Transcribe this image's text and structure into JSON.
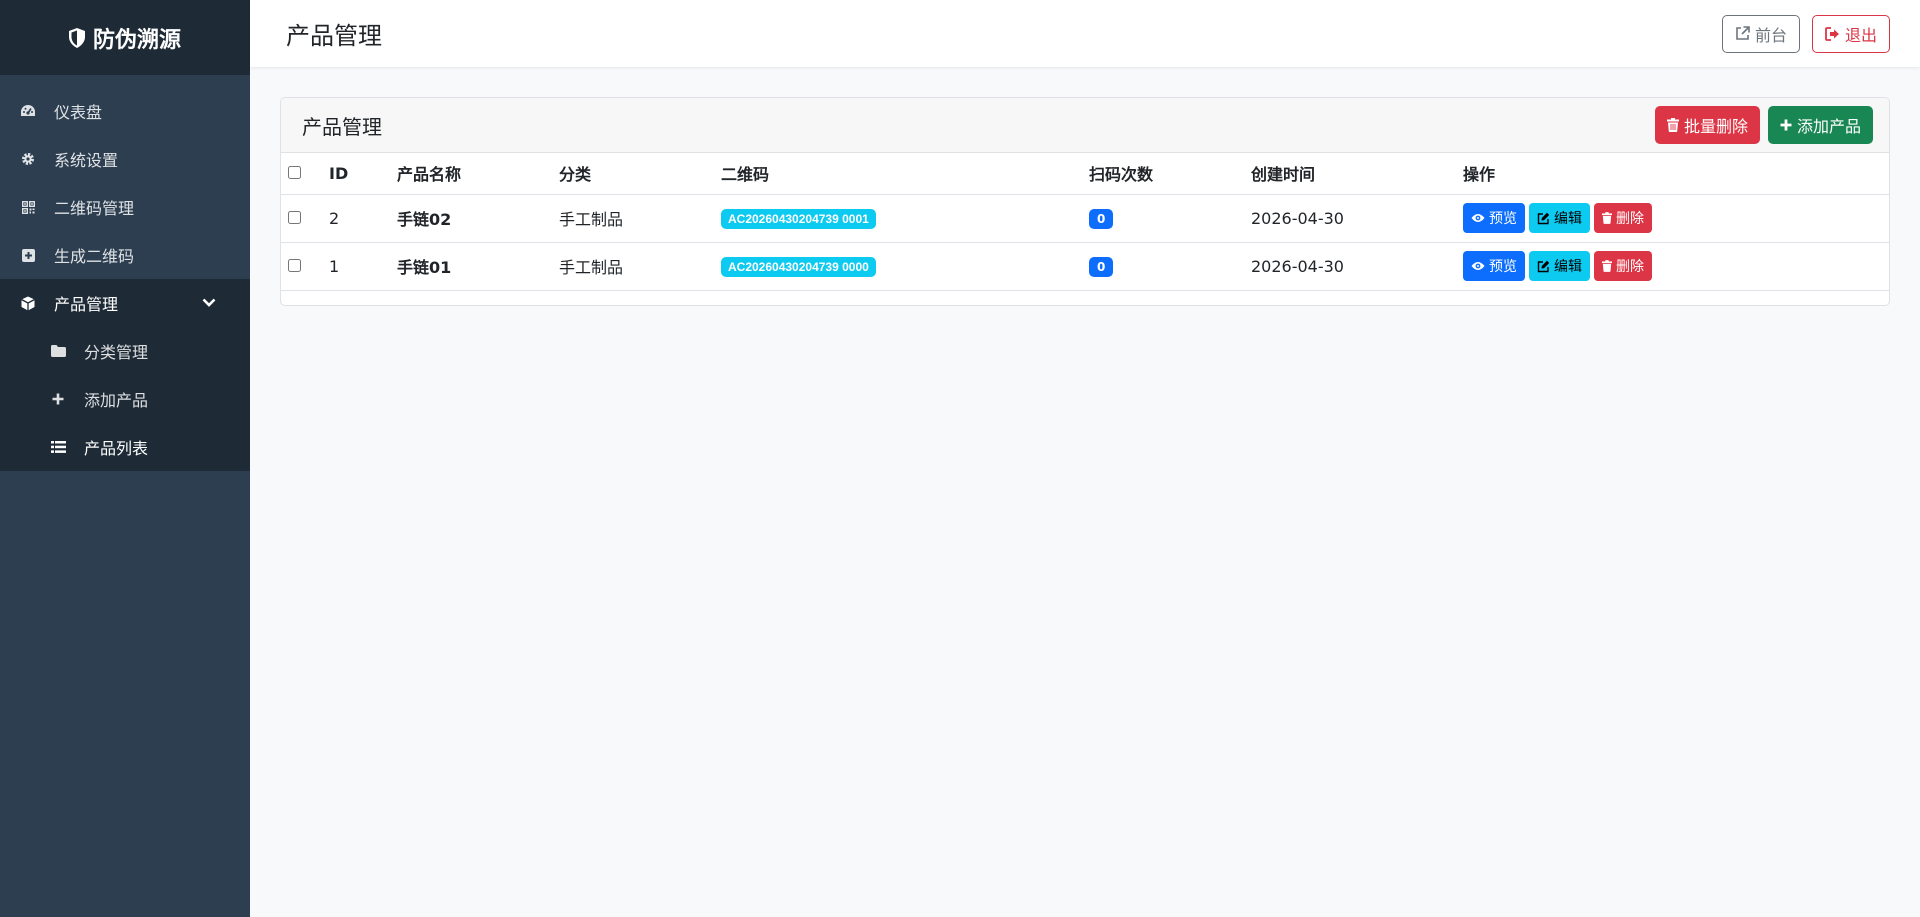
{
  "brand": {
    "title": "防伪溯源"
  },
  "sidebar": {
    "items": [
      {
        "label": "仪表盘",
        "icon": "dashboard-icon"
      },
      {
        "label": "系统设置",
        "icon": "gear-icon"
      },
      {
        "label": "二维码管理",
        "icon": "qrcode-icon"
      },
      {
        "label": "生成二维码",
        "icon": "plus-square-icon"
      },
      {
        "label": "产品管理",
        "icon": "cube-icon",
        "expanded": true
      }
    ],
    "submenu": [
      {
        "label": "分类管理",
        "icon": "folder-icon"
      },
      {
        "label": "添加产品",
        "icon": "plus-icon"
      },
      {
        "label": "产品列表",
        "icon": "list-icon",
        "active": true
      }
    ]
  },
  "header": {
    "title": "产品管理",
    "frontend_label": "前台",
    "logout_label": "退出"
  },
  "card": {
    "title": "产品管理",
    "batch_delete_label": "批量删除",
    "add_product_label": "添加产品"
  },
  "table": {
    "columns": [
      "ID",
      "产品名称",
      "分类",
      "二维码",
      "扫码次数",
      "创建时间",
      "操作"
    ],
    "rows": [
      {
        "id": "2",
        "name": "手链02",
        "category": "手工制品",
        "qrcode": "AC20260430204739 0001",
        "scans": "0",
        "created": "2026-04-30"
      },
      {
        "id": "1",
        "name": "手链01",
        "category": "手工制品",
        "qrcode": "AC20260430204739 0000",
        "scans": "0",
        "created": "2026-04-30"
      }
    ],
    "actions": {
      "preview": "预览",
      "edit": "编辑",
      "delete": "删除"
    }
  },
  "colors": {
    "sidebar": "#2c3e50",
    "sidebar_dark": "#1e2a36",
    "primary": "#0d6efd",
    "info": "#0dcaf0",
    "danger": "#dc3545",
    "success": "#198754"
  }
}
